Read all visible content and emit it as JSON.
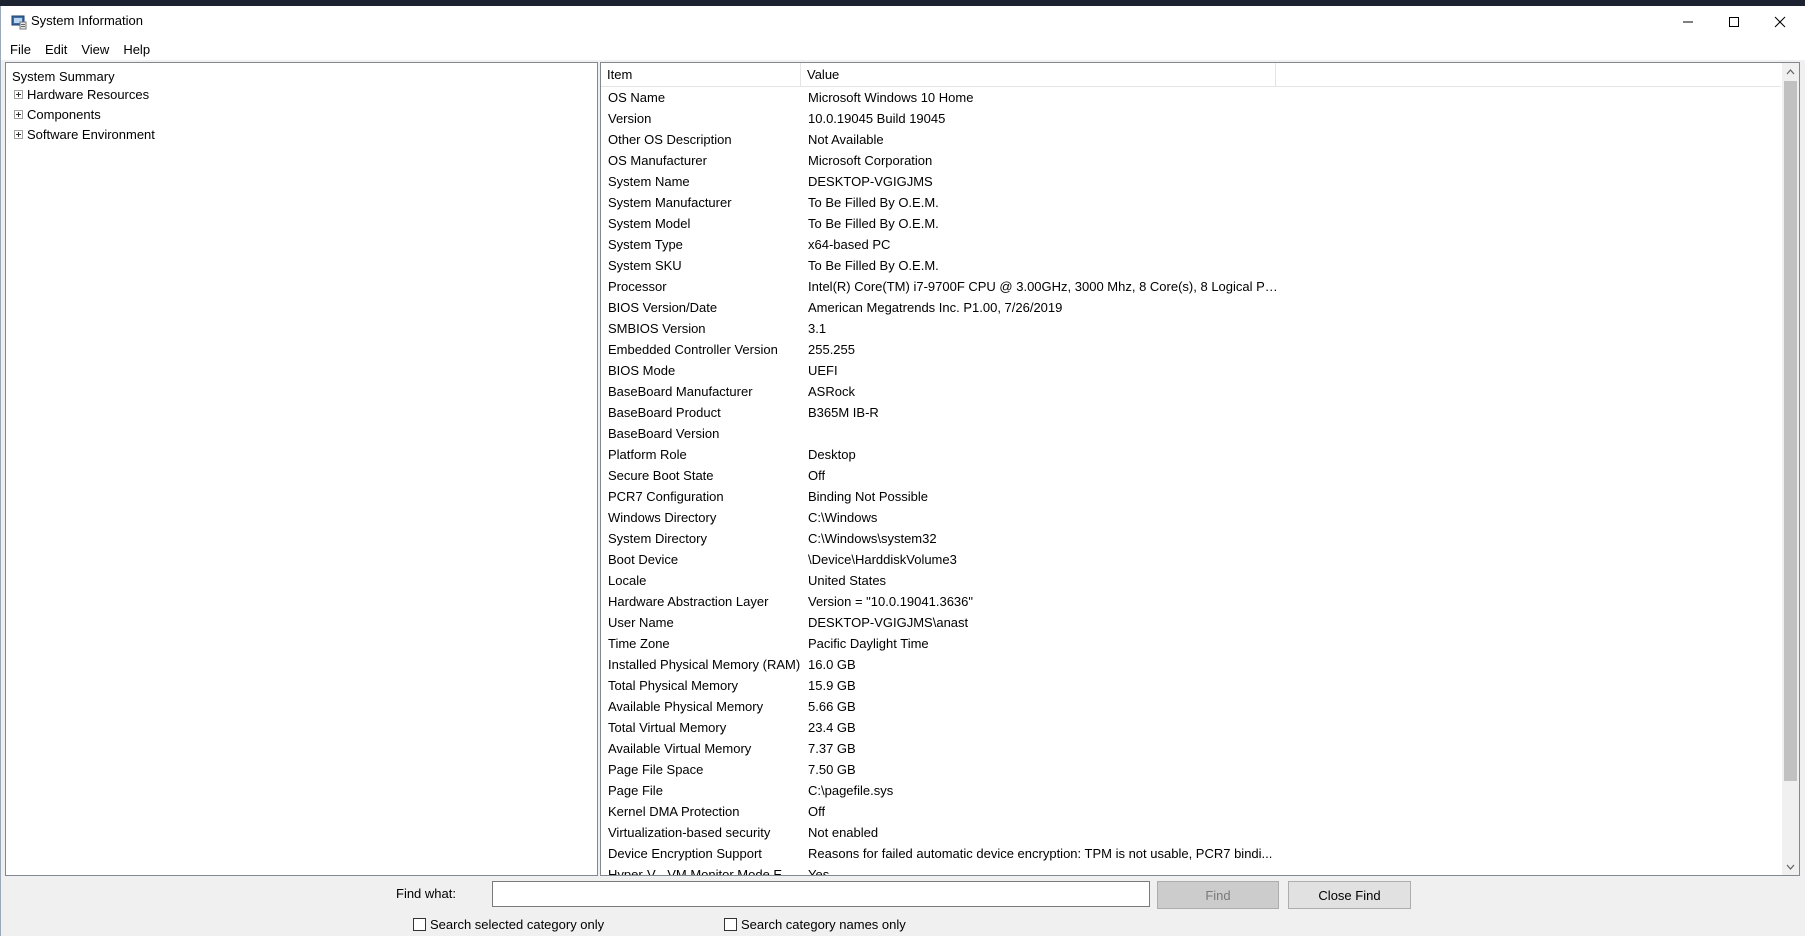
{
  "window": {
    "title": "System Information"
  },
  "menu": [
    "File",
    "Edit",
    "View",
    "Help"
  ],
  "tree": {
    "root": "System Summary",
    "nodes": [
      "Hardware Resources",
      "Components",
      "Software Environment"
    ]
  },
  "table": {
    "headers": {
      "item": "Item",
      "value": "Value"
    },
    "rows": [
      {
        "item": "OS Name",
        "value": "Microsoft Windows 10 Home"
      },
      {
        "item": "Version",
        "value": "10.0.19045 Build 19045"
      },
      {
        "item": "Other OS Description",
        "value": "Not Available"
      },
      {
        "item": "OS Manufacturer",
        "value": "Microsoft Corporation"
      },
      {
        "item": "System Name",
        "value": "DESKTOP-VGIGJMS"
      },
      {
        "item": "System Manufacturer",
        "value": "To Be Filled By O.E.M."
      },
      {
        "item": "System Model",
        "value": "To Be Filled By O.E.M."
      },
      {
        "item": "System Type",
        "value": "x64-based PC"
      },
      {
        "item": "System SKU",
        "value": "To Be Filled By O.E.M."
      },
      {
        "item": "Processor",
        "value": "Intel(R) Core(TM) i7-9700F CPU @ 3.00GHz, 3000 Mhz, 8 Core(s), 8 Logical Pr..."
      },
      {
        "item": "BIOS Version/Date",
        "value": "American Megatrends Inc. P1.00, 7/26/2019"
      },
      {
        "item": "SMBIOS Version",
        "value": "3.1"
      },
      {
        "item": "Embedded Controller Version",
        "value": "255.255"
      },
      {
        "item": "BIOS Mode",
        "value": "UEFI"
      },
      {
        "item": "BaseBoard Manufacturer",
        "value": "ASRock"
      },
      {
        "item": "BaseBoard Product",
        "value": "B365M IB-R"
      },
      {
        "item": "BaseBoard Version",
        "value": ""
      },
      {
        "item": "Platform Role",
        "value": "Desktop"
      },
      {
        "item": "Secure Boot State",
        "value": "Off"
      },
      {
        "item": "PCR7 Configuration",
        "value": "Binding Not Possible"
      },
      {
        "item": "Windows Directory",
        "value": "C:\\Windows"
      },
      {
        "item": "System Directory",
        "value": "C:\\Windows\\system32"
      },
      {
        "item": "Boot Device",
        "value": "\\Device\\HarddiskVolume3"
      },
      {
        "item": "Locale",
        "value": "United States"
      },
      {
        "item": "Hardware Abstraction Layer",
        "value": "Version = \"10.0.19041.3636\""
      },
      {
        "item": "User Name",
        "value": "DESKTOP-VGIGJMS\\anast"
      },
      {
        "item": "Time Zone",
        "value": "Pacific Daylight Time"
      },
      {
        "item": "Installed Physical Memory (RAM)",
        "value": "16.0 GB"
      },
      {
        "item": "Total Physical Memory",
        "value": "15.9 GB"
      },
      {
        "item": "Available Physical Memory",
        "value": "5.66 GB"
      },
      {
        "item": "Total Virtual Memory",
        "value": "23.4 GB"
      },
      {
        "item": "Available Virtual Memory",
        "value": "7.37 GB"
      },
      {
        "item": "Page File Space",
        "value": "7.50 GB"
      },
      {
        "item": "Page File",
        "value": "C:\\pagefile.sys"
      },
      {
        "item": "Kernel DMA Protection",
        "value": "Off"
      },
      {
        "item": "Virtualization-based security",
        "value": "Not enabled"
      },
      {
        "item": "Device Encryption Support",
        "value": "Reasons for failed automatic device encryption: TPM is not usable, PCR7 bindi..."
      },
      {
        "item": "Hyper-V - VM Monitor Mode E...",
        "value": "Yes"
      }
    ]
  },
  "find": {
    "label": "Find what:",
    "value": "",
    "find_button": "Find",
    "close_button": "Close Find",
    "check_selected": "Search selected category only",
    "check_names": "Search category names only"
  },
  "colors": {
    "accent": "#0078d7",
    "disabled_button": "#cccccc"
  }
}
